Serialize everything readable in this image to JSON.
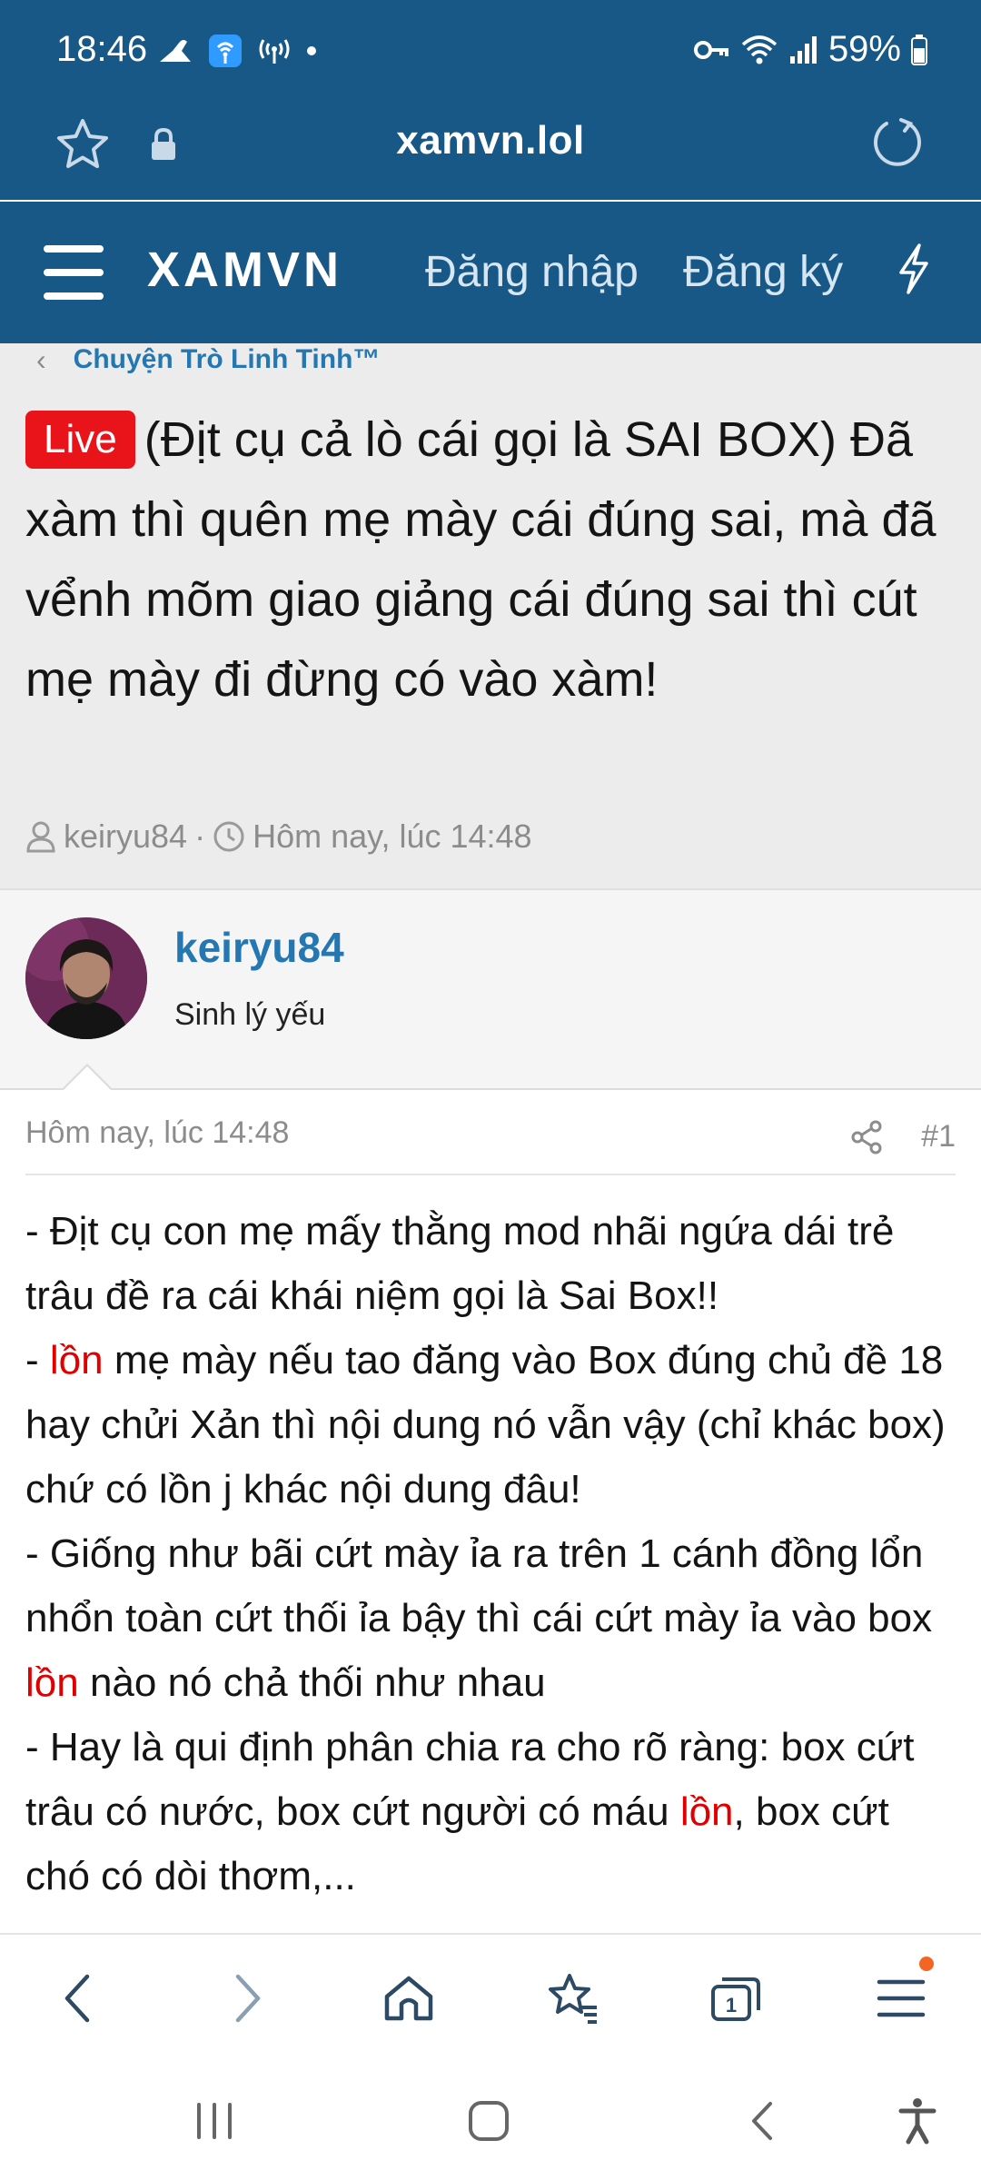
{
  "status_bar": {
    "time": "18:46",
    "battery": "59%"
  },
  "url_bar": {
    "url": "xamvn.lol"
  },
  "site_header": {
    "logo": "XAMVN",
    "login_label": "Đăng nhập",
    "register_label": "Đăng ký"
  },
  "breadcrumb": {
    "label": "Chuyện Trò Linh Tinh™"
  },
  "thread": {
    "badge": "Live",
    "title": "(Địt cụ cả lò cái gọi là SAI BOX) Đã xàm thì quên mẹ mày cái đúng sai, mà đã vểnh mõm giao giảng cái đúng sai thì cút mẹ mày đi đừng có vào xàm!",
    "author": "keiryu84",
    "separator": "·",
    "date": "Hôm nay, lúc 14:48"
  },
  "author_block": {
    "name": "keiryu84",
    "title": "Sinh lý yếu"
  },
  "post": {
    "date": "Hôm nay, lúc 14:48",
    "number": "#1",
    "p1": "- Địt cụ con mẹ mấy thằng mod nhãi ngứa dái trẻ trâu đề ra cái khái niệm gọi là Sai Box!!",
    "p2_pre": "- ",
    "p2_red": "lồn",
    "p2_post": " mẹ mày nếu tao đăng vào Box đúng chủ đề 18 hay chửi Xản thì nội dung nó vẫn vậy (chỉ khác box) chứ có lồn j khác nội dung đâu!",
    "p3_pre": "- Giống như bãi cứt mày ỉa ra trên 1 cánh đồng lổn nhổn toàn cứt thối ỉa bậy thì cái cứt mày ỉa vào box ",
    "p3_red": "lồn",
    "p3_post": " nào nó chả thối như nhau",
    "p4_pre": "- Hay là qui định phân chia ra cho rõ ràng: box cứt trâu có nước, box cứt người có máu ",
    "p4_red": "lồn",
    "p4_post": ", box cứt chó có dòi thơm,..."
  },
  "colors": {
    "header_bg": "#185886",
    "link": "#2577b1",
    "live_badge": "#e8141a",
    "highlight_red": "#e00000",
    "notification_dot": "#f26522"
  },
  "icons": [
    "flight-mode-icon",
    "wifi-calling-icon",
    "hotspot-icon",
    "key-icon",
    "wifi-icon",
    "signal-icon",
    "battery-icon",
    "star-icon",
    "lock-icon",
    "reload-icon",
    "menu-icon",
    "bolt-icon",
    "user-icon",
    "clock-icon",
    "share-icon",
    "back-icon",
    "forward-icon",
    "home-icon",
    "bookmarks-icon",
    "tabs-icon",
    "menu-icon",
    "recents-icon",
    "home-button-icon",
    "accessibility-icon"
  ]
}
